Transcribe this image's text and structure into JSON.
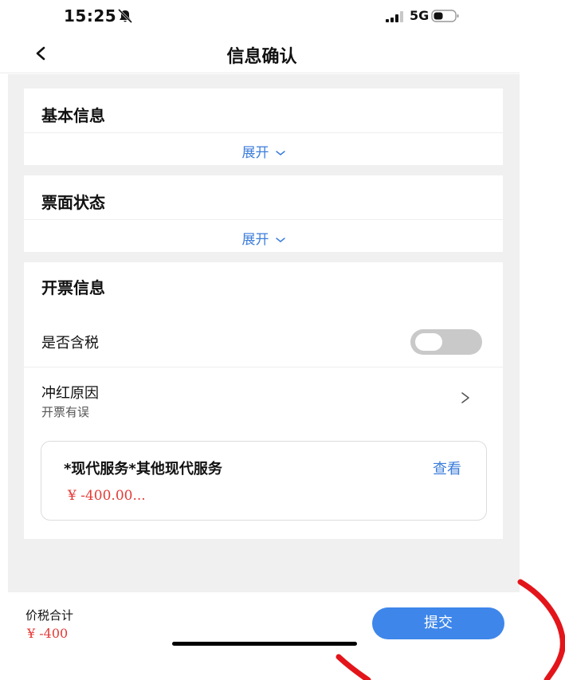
{
  "status_bar": {
    "time": "15:25",
    "network": "5G"
  },
  "nav": {
    "title": "信息确认"
  },
  "sections": {
    "basic": {
      "title": "基本信息",
      "expand_label": "展开"
    },
    "ticket": {
      "title": "票面状态",
      "expand_label": "展开"
    },
    "invoice": {
      "title": "开票信息",
      "tax_row": {
        "label": "是否含税",
        "toggle_on": false
      },
      "reason_row": {
        "label": "冲红原因",
        "value": "开票有误"
      },
      "item": {
        "name": "*现代服务*其他现代服务",
        "view_label": "查看",
        "amount": "¥ -400.00..."
      }
    }
  },
  "footer": {
    "total_label": "价税合计",
    "total_value": "¥ -400",
    "submit_label": "提交"
  },
  "colors": {
    "accent": "#3e86ea",
    "link": "#3c7ddb",
    "amount": "#e53935",
    "annotation": "#e3151a"
  },
  "icons": [
    "bell-mute-icon",
    "signal-icon",
    "battery-icon",
    "back-icon",
    "chevron-down-icon",
    "chevron-right-icon"
  ]
}
